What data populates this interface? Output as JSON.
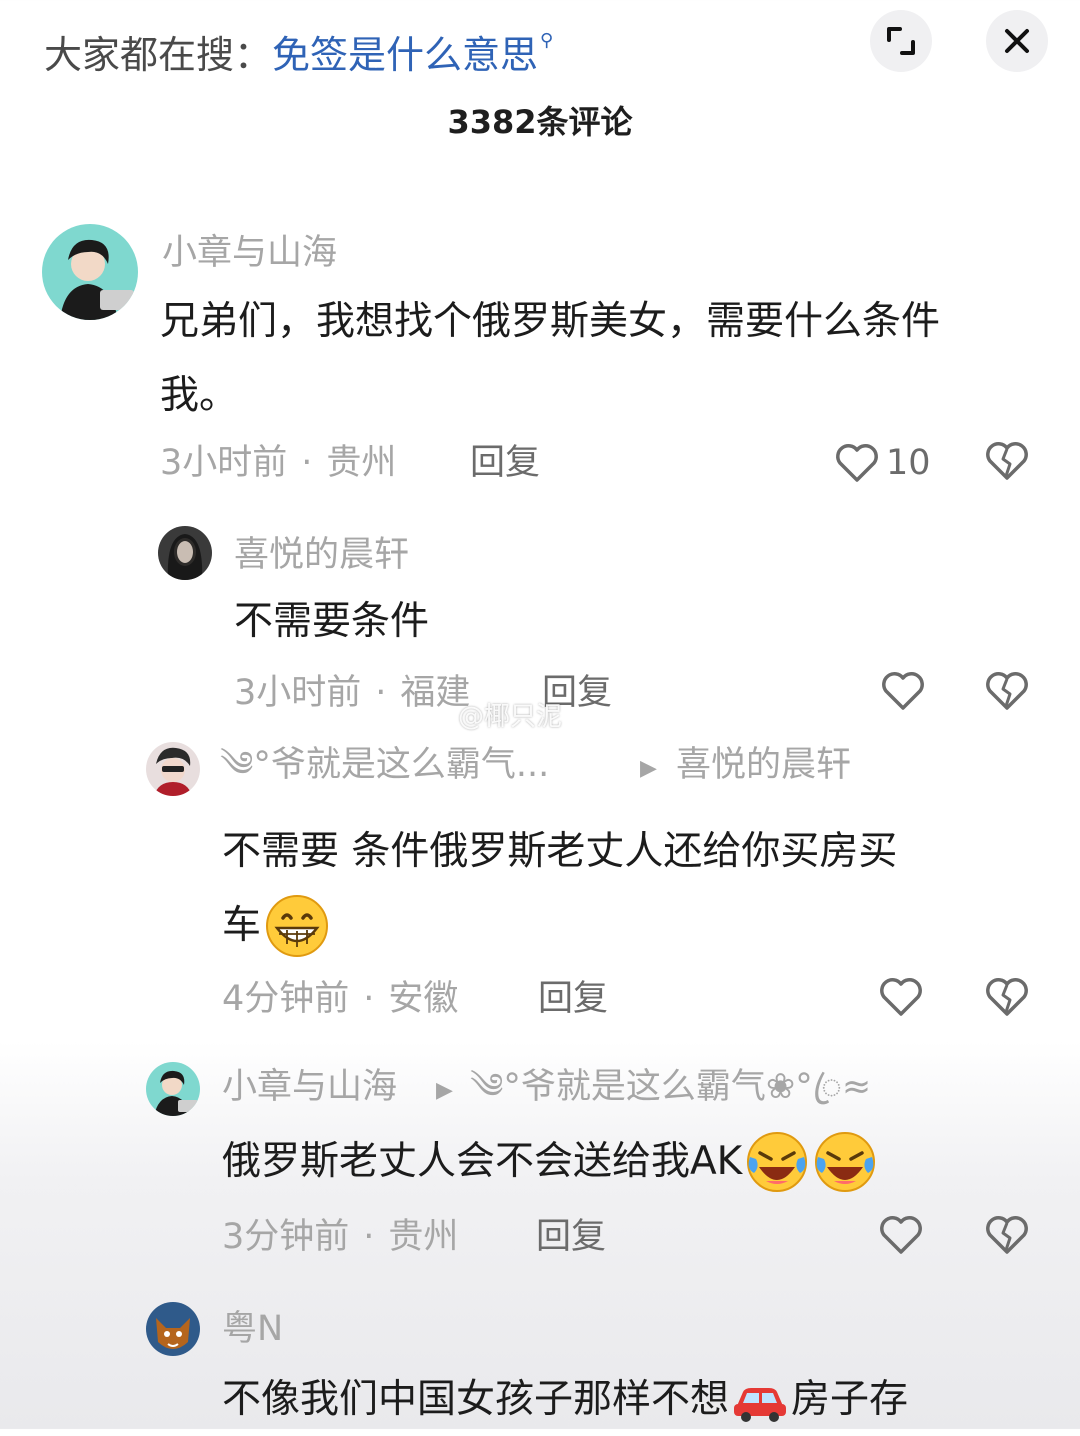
{
  "header": {
    "search_prefix": "大家都在搜：",
    "search_keyword": "免签是什么意思",
    "comment_count": "3382条评论"
  },
  "comments": [
    {
      "user": "小章与山海",
      "text_line1": "兄弟们，我想找个俄罗斯美女，需要什么条件",
      "text_line2": "我。",
      "time": "3小时前",
      "location": "贵州",
      "reply": "回复",
      "likes": "10"
    },
    {
      "user": "喜悦的晨轩",
      "text_line1": "不需要条件",
      "time": "3小时前",
      "location": "福建",
      "reply": "回复"
    },
    {
      "user": "༄°爷就是这么霸气...",
      "reply_to": "喜悦的晨轩",
      "text_line1": "不需要 条件俄罗斯老丈人还给你买房买",
      "text_line2": "车",
      "time": "4分钟前",
      "location": "安徽",
      "reply": "回复"
    },
    {
      "user": "小章与山海",
      "reply_to": "༄°爷就是这么霸气❀°ꦿ≈",
      "text_line1": "俄罗斯老丈人会不会送给我AK",
      "time": "3分钟前",
      "location": "贵州",
      "reply": "回复"
    },
    {
      "user": "粤N",
      "text_line1": "不像我们中国女孩子那样不想",
      "text_line1_after": "房子存"
    }
  ],
  "watermark": "@椰只泥",
  "icons": {
    "expand": "expand-icon",
    "close": "close-icon",
    "like": "heart-icon",
    "dislike": "broken-heart-icon",
    "emoji_grin": "grinning-face-icon",
    "emoji_laugh": "rolling-laughing-icon",
    "emoji_car": "car-icon"
  }
}
